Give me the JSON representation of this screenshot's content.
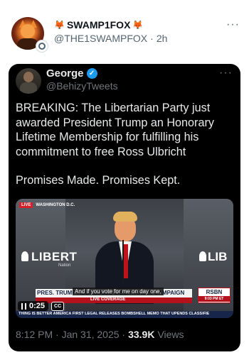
{
  "post": {
    "display_name": "SWAMP1FOX",
    "fox_emoji": "🦊",
    "handle": "@THE1SWAMPFOX",
    "separator": "·",
    "time_ago": "2h",
    "more": "···"
  },
  "quoted": {
    "display_name": "George",
    "verified_icon": "✓",
    "handle": "@BehizyTweets",
    "more": "···",
    "text_paragraph_1": "BREAKING: The Libertarian Party just awarded President Trump an Honorary Lifetime Membership for fulfilling his commitment to free Ross Ulbricht",
    "text_paragraph_2": "Promises Made. Promises Kept.",
    "timestamp": "8:12 PM · Jan 31, 2025 ·",
    "views_count": "33.9K",
    "views_label": "Views"
  },
  "video": {
    "live_badge": "LIVE",
    "location": "WASHINGTON D.C.",
    "stage_text_left": "LIBERT",
    "stage_subtext_left": "Nation",
    "stage_text_right": "LIB",
    "lower_third_title": "PRES. TRUMP ADDRESSES LIBERTARIAN CAMPAIGN",
    "caption": "And if you vote for me on day one,",
    "live_coverage": "LIVE COVERAGE",
    "network": "RSBN",
    "network_time": "9:03 PM ET",
    "ticker": "THING IS BETTER    AMERICA FIRST LEGAL RELEASES BOMBSHELL MEMO THAT UPENDS CLASSIFIE",
    "elapsed": "0:25",
    "cc_label": "CC"
  }
}
